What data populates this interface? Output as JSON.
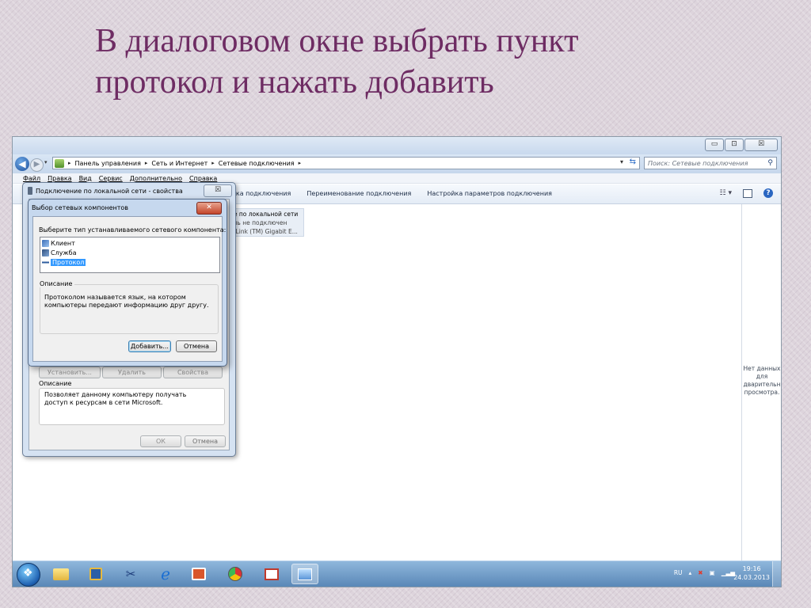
{
  "slide": {
    "title_lines": [
      "В диалоговом окне выбрать  пункт",
      "протокол и нажать добавить"
    ]
  },
  "window": {
    "controls": {
      "minimize": "▭",
      "maximize": "⊡",
      "close": "☒"
    },
    "address": {
      "back": "◀",
      "forward": "▶",
      "dropdown": "▾",
      "arrow": "▸",
      "breadcrumbs": [
        "Панель управления",
        "Сеть и Интернет",
        "Сетевые подключения"
      ],
      "search_placeholder": "Поиск: Сетевые подключения"
    },
    "menu": [
      "Файл",
      "Правка",
      "Вид",
      "Сервис",
      "Дополнительно",
      "Справка"
    ],
    "commands": [
      "тика подключения",
      "Переименование подключения",
      "Настройка параметров подключения"
    ],
    "connection_tile": [
      "ие по локальной сети",
      "ель не подключен",
      "etLink (TM) Gigabit E..."
    ],
    "preview_text": "Нет данных для дварительн просмотра."
  },
  "properties_dialog": {
    "title": "Подключение по локальной сети - свойства",
    "buttons": {
      "install": "Установить...",
      "remove": "Удалить",
      "properties": "Свойства"
    },
    "description_label": "Описание",
    "description_text": "Позволяет данному компьютеру получать доступ к ресурсам в сети Microsoft.",
    "ok": "ОК",
    "cancel": "Отмена"
  },
  "component_dialog": {
    "title": "Выбор сетевых компонентов",
    "prompt": "Выберите тип устанавливаемого сетевого компонента:",
    "items": [
      "Клиент",
      "Служба",
      "Протокол"
    ],
    "selected_index": 2,
    "description_label": "Описание",
    "description_text": "Протоколом называется язык, на котором компьютеры передают информацию друг другу.",
    "add_button": "Добавить...",
    "cancel_button": "Отмена"
  },
  "taskbar": {
    "language": "RU",
    "time": "19:16",
    "date": "24.03.2013"
  },
  "colors": {
    "title": "#6e2c63",
    "selection": "#3399ff",
    "taskbar": "#5886b6"
  }
}
